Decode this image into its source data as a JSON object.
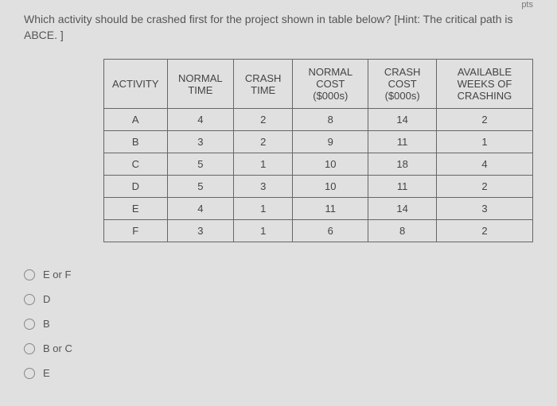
{
  "fragment": "pts",
  "question": "Which activity should be crashed first for the project shown in table below? [Hint: The critical path is ABCE. ]",
  "table": {
    "headers": [
      "ACTIVITY",
      "NORMAL TIME",
      "CRASH TIME",
      "NORMAL COST ($000s)",
      "CRASH COST ($000s)",
      "AVAILABLE WEEKS OF CRASHING"
    ],
    "rows": [
      {
        "activity": "A",
        "normal_time": "4",
        "crash_time": "2",
        "normal_cost": "8",
        "crash_cost": "14",
        "available": "2"
      },
      {
        "activity": "B",
        "normal_time": "3",
        "crash_time": "2",
        "normal_cost": "9",
        "crash_cost": "11",
        "available": "1"
      },
      {
        "activity": "C",
        "normal_time": "5",
        "crash_time": "1",
        "normal_cost": "10",
        "crash_cost": "18",
        "available": "4"
      },
      {
        "activity": "D",
        "normal_time": "5",
        "crash_time": "3",
        "normal_cost": "10",
        "crash_cost": "11",
        "available": "2"
      },
      {
        "activity": "E",
        "normal_time": "4",
        "crash_time": "1",
        "normal_cost": "11",
        "crash_cost": "14",
        "available": "3"
      },
      {
        "activity": "F",
        "normal_time": "3",
        "crash_time": "1",
        "normal_cost": "6",
        "crash_cost": "8",
        "available": "2"
      }
    ]
  },
  "options": [
    {
      "label": "E or F"
    },
    {
      "label": "D"
    },
    {
      "label": "B"
    },
    {
      "label": "B or C"
    },
    {
      "label": "E"
    }
  ]
}
